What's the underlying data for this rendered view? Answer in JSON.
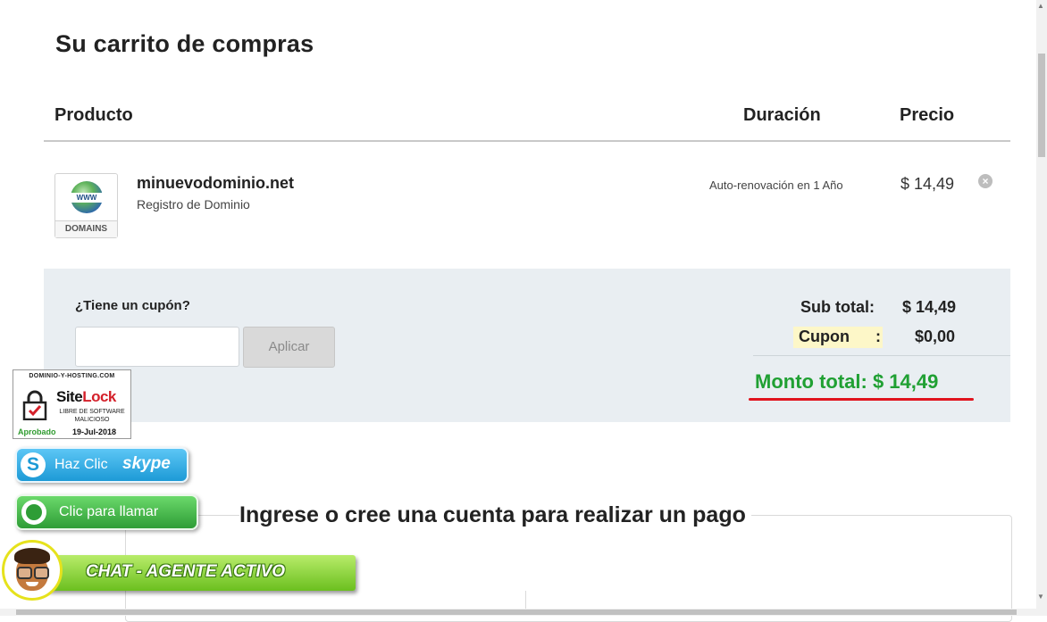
{
  "cart": {
    "title": "Su carrito de compras",
    "headers": {
      "product": "Producto",
      "duration": "Duración",
      "price": "Precio"
    },
    "items": [
      {
        "thumb_www": "WWW",
        "thumb_label": "DOMAINS",
        "name": "minuevodominio.net",
        "type": "Registro de Dominio",
        "duration": "Auto-renovación en 1 Año",
        "price": "$ 14,49",
        "remove_icon": "close-circle-icon"
      }
    ]
  },
  "summary": {
    "coupon_question": "¿Tiene un cupón?",
    "coupon_placeholder": "",
    "apply_label": "Aplicar",
    "subtotal_label": "Sub total:",
    "subtotal_value": "$ 14,49",
    "coupon_label": "Cupon",
    "coupon_colon": ":",
    "coupon_value": "$0,00",
    "total_text": "Monto total: $ 14,49"
  },
  "sitelock": {
    "site": "DOMINIO-Y-HOSTING.COM",
    "brand_1": "Site",
    "brand_2": "Lock",
    "sub_1": "LIBRE DE SOFTWARE",
    "sub_2": "MALICIOSO",
    "status": "Aprobado",
    "date": "19-Jul-2018"
  },
  "widgets": {
    "skype_text": "Haz Clic",
    "skype_logo": "skype",
    "whatsapp_text": "Clic para llamar",
    "chat_text": "CHAT - AGENTE ACTIVO"
  },
  "login": {
    "title": "Ingrese o cree una cuenta para realizar un pago"
  },
  "colors": {
    "total_green": "#20a033",
    "underline_red": "#e0141e",
    "summary_bg": "#e9eef2",
    "coupon_highlight": "#fdf7c8"
  }
}
